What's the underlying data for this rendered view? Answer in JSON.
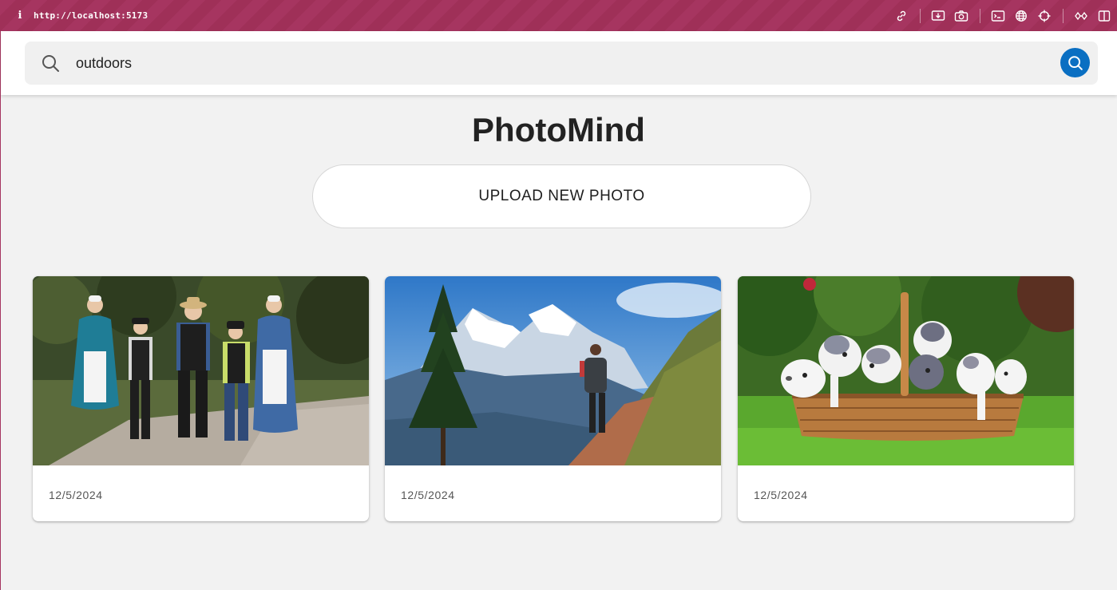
{
  "browser": {
    "info_glyph": "i",
    "url": "http://localhost:5173",
    "toolbar_icons": [
      "link-icon",
      "download-screen-icon",
      "camera-icon",
      "terminal-icon",
      "globe-icon",
      "crosshair-icon",
      "extensions-icon",
      "sidebar-icon"
    ]
  },
  "search": {
    "value": "outdoors",
    "icon": "search-icon",
    "submit_icon": "search-icon"
  },
  "app": {
    "title": "PhotoMind",
    "upload_label": "UPLOAD NEW PHOTO"
  },
  "photos": [
    {
      "date": "12/5/2024",
      "subject": "family-portrait-outdoors"
    },
    {
      "date": "12/5/2024",
      "subject": "hiker-on-mountain-trail"
    },
    {
      "date": "12/5/2024",
      "subject": "puppies-in-basket"
    }
  ],
  "colors": {
    "chrome": "#a63560",
    "accent": "#0a6fc2",
    "background": "#f2f2f2"
  }
}
